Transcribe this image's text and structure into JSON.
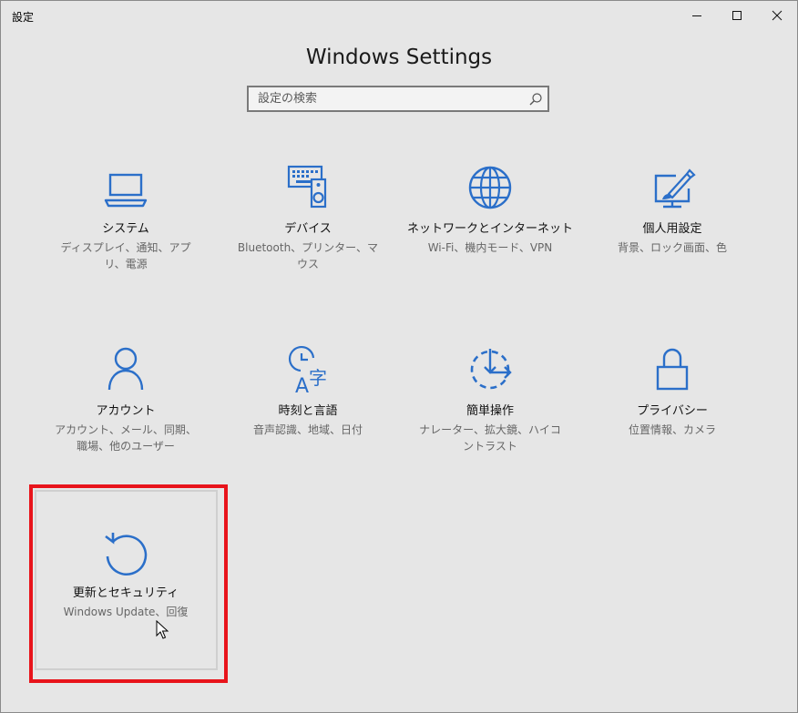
{
  "window": {
    "title": "設定",
    "controls": [
      "minimize-icon",
      "maximize-icon",
      "close-icon"
    ]
  },
  "heading": "Windows Settings",
  "search": {
    "placeholder": "設定の検索",
    "icon": "search-icon"
  },
  "tiles": [
    {
      "name": "システム",
      "desc": "ディスプレイ、通知、アプリ、電源",
      "icon": "laptop-icon"
    },
    {
      "name": "デバイス",
      "desc": "Bluetooth、プリンター、マウス",
      "icon": "keyboard-speaker-icon"
    },
    {
      "name": "ネットワークとインターネット",
      "desc": "Wi-Fi、機内モード、VPN",
      "icon": "globe-icon"
    },
    {
      "name": "個人用設定",
      "desc": "背景、ロック画面、色",
      "icon": "paint-monitor-icon"
    },
    {
      "name": "アカウント",
      "desc": "アカウント、メール、同期、職場、他のユーザー",
      "icon": "person-icon"
    },
    {
      "name": "時刻と言語",
      "desc": "音声認識、地域、日付",
      "icon": "time-language-icon"
    },
    {
      "name": "簡単操作",
      "desc": "ナレーター、拡大鏡、ハイコントラスト",
      "icon": "ease-of-access-icon"
    },
    {
      "name": "プライバシー",
      "desc": "位置情報、カメラ",
      "icon": "lock-icon"
    },
    {
      "name": "更新とセキュリティ",
      "desc": "Windows Update、回復",
      "icon": "update-refresh-icon"
    }
  ],
  "colors": {
    "accent": "#2b6fc9",
    "highlight": "#e8141b",
    "background": "#e6e6e6"
  }
}
